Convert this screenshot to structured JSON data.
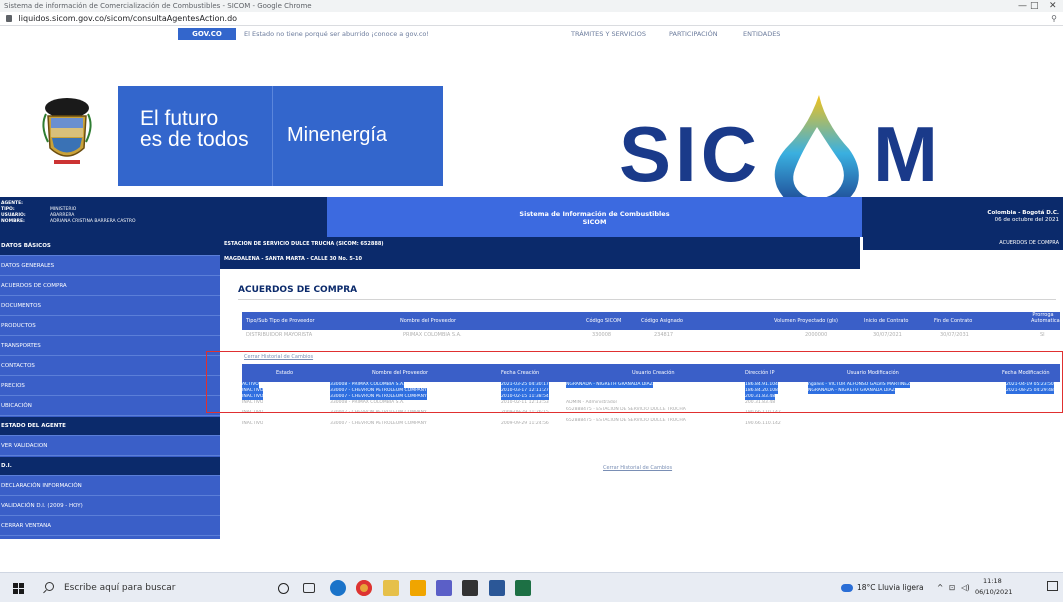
{
  "browser": {
    "window_title": "Sistema de información de Comercialización de Combustibles - SICOM - Google Chrome",
    "url": "liquidos.sicom.gov.co/sicom/consultaAgentesAction.do",
    "minimize": "—",
    "restore": "□",
    "close": "✕"
  },
  "govbar": {
    "brand": "GOV.CO",
    "slogan": "El Estado no tiene porqué ser aburrido ¡conoce a gov.co!",
    "links": [
      "TRÁMITES Y SERVICIOS",
      "PARTICIPACIÓN",
      "ENTIDADES"
    ]
  },
  "banner": {
    "futuro_line1": "El futuro",
    "futuro_line2": "es de todos",
    "ministry": "Minenergía",
    "logo_left": "SIC",
    "logo_right": "M"
  },
  "agent": {
    "agente_label": "AGENTE:",
    "tipo_label": "TIPO:",
    "tipo_value": "MINISTERIO",
    "usuario_label": "USUARIO:",
    "usuario_value": "ABARRERA",
    "nombre_label": "NOMBRE:",
    "nombre_value": "ADRIANA CRISTINA BARRERA CASTRO"
  },
  "system": {
    "line1": "Sistema de Información de Combustibles",
    "line2": "SICOM"
  },
  "location": {
    "place": "Colombia - Bogotá D.C.",
    "date": "06 de octubre del 2021"
  },
  "sidebar": {
    "items": [
      {
        "label": "DATOS BÁSICOS",
        "header": true
      },
      {
        "label": "DATOS GENERALES",
        "header": false
      },
      {
        "label": "ACUERDOS DE COMPRA",
        "header": false
      },
      {
        "label": "DOCUMENTOS",
        "header": false
      },
      {
        "label": "PRODUCTOS",
        "header": false
      },
      {
        "label": "TRANSPORTES",
        "header": false
      },
      {
        "label": "CONTACTOS",
        "header": false
      },
      {
        "label": "PRECIOS",
        "header": false
      },
      {
        "label": "UBICACIÓN",
        "header": false
      },
      {
        "label": "ESTADO DEL AGENTE",
        "header": true
      },
      {
        "label": "VER VALIDACION",
        "header": false
      },
      {
        "label": "D.I.",
        "header": true
      },
      {
        "label": "DECLARACIÓN INFORMACIÓN",
        "header": false
      },
      {
        "label": "VALIDACIÓN D.I. (2009 - HOY)",
        "header": false
      },
      {
        "label": "CERRAR VENTANA",
        "header": false
      }
    ]
  },
  "station": {
    "name": "ESTACION DE SERVICIO DULCE TRUCHA (SICOM: 652888)",
    "address": "MAGDALENA - SANTA MARTA - CALLE 30 No. 5-10",
    "acuerdos_button": "ACUERDOS DE COMPRA"
  },
  "acuerdos": {
    "title": "ACUERDOS DE COMPRA",
    "columns": [
      "Tipo/Sub Tipo de Proveedor",
      "Nombre del Proveedor",
      "Código SICOM",
      "Código Asignado",
      "Volumen Proyectado (gls)",
      "Inicio de Contrato",
      "Fin de Contrato",
      "Prorroga Automatica"
    ],
    "row": [
      "DISTRIBUIDOR MAYORISTA",
      "PRIMAX COLOMBIA S.A.",
      "330008",
      "234817",
      "2000000",
      "30/07/2021",
      "30/07/2031",
      "SI"
    ]
  },
  "historial": {
    "link_top": "Cerrar Historial de Cambios",
    "link_bottom": "Cerrar Historial de Cambios",
    "columns": [
      "Estado",
      "Nombre del Proveedor",
      "Fecha Creación",
      "Usuario Creación",
      "Dirección IP",
      "Usuario Modificación",
      "Fecha Modificación"
    ],
    "rows": [
      {
        "estado": "ACTIVO",
        "proveedor": "330008 - PRIMAX COLOMBIA S.A.",
        "fecha": "2021-03-25 04:30:17",
        "usuario": "NGRANADA - NIGRETH GRANADA DIAZ",
        "ip": "186.84.91.104",
        "umod": "ngalvis - VICTOR ALFONSO GALVIS MARTINEZ",
        "fmod": "2021-04-19 05:23:50",
        "selected": true
      },
      {
        "estado": "INACTIVO",
        "proveedor": "330007 - CHEVRON PETROLEUM COMPANY",
        "fecha": "2010-03-17 12:11:27",
        "usuario": "",
        "ip": "186.84.20.108",
        "umod": "NGRANADA - NIGRETH GRANADA DIAZ",
        "fmod": "2021-08-25 04:29:48",
        "selected": true
      },
      {
        "estado": "INACTIVO",
        "proveedor": "330007 - CHEVRON PETROLEUM COMPANY",
        "fecha": "2010-02-15 11:38:54",
        "usuario": "",
        "ip": "200.31.83.48",
        "umod": "",
        "fmod": "",
        "selected": true
      },
      {
        "estado": "INACTIVO",
        "proveedor": "330008 - PRIMAX COLOMBIA S.A.",
        "fecha": "2010-02-11 12:13:53",
        "usuario": "ADMIN - Administrador",
        "ip": "200.31.83.48",
        "umod": "",
        "fmod": "",
        "selected": false
      },
      {
        "estado": "INACTIVO",
        "proveedor": "330007 - CHEVRON PETROLEUM COMPANY",
        "fecha": "2009-09-29 11:26:15",
        "usuario": "652888475 - ESTACION DE SERVICIO DULCE TRUCHA",
        "ip": "190.66.110.142",
        "umod": "",
        "fmod": "",
        "selected": false
      },
      {
        "estado": "INACTIVO",
        "proveedor": "330007 - CHEVRON PETROLEUM COMPANY",
        "fecha": "2009-09-29 11:24:56",
        "usuario": "652888475 - ESTACION DE SERVICIO DULCE TRUCHA",
        "ip": "190.66.110.142",
        "umod": "",
        "fmod": "",
        "selected": false
      }
    ]
  },
  "taskbar": {
    "search_placeholder": "Escribe aquí para buscar",
    "weather": "18°C  Lluvia ligera",
    "time": "11:18",
    "date": "06/10/2021"
  },
  "colors": {
    "navy": "#0b2a6b",
    "blue": "#3a5fc8",
    "govblue": "#3366cc",
    "highlight": "#2f6fe0",
    "annotation_red": "#e03030"
  }
}
